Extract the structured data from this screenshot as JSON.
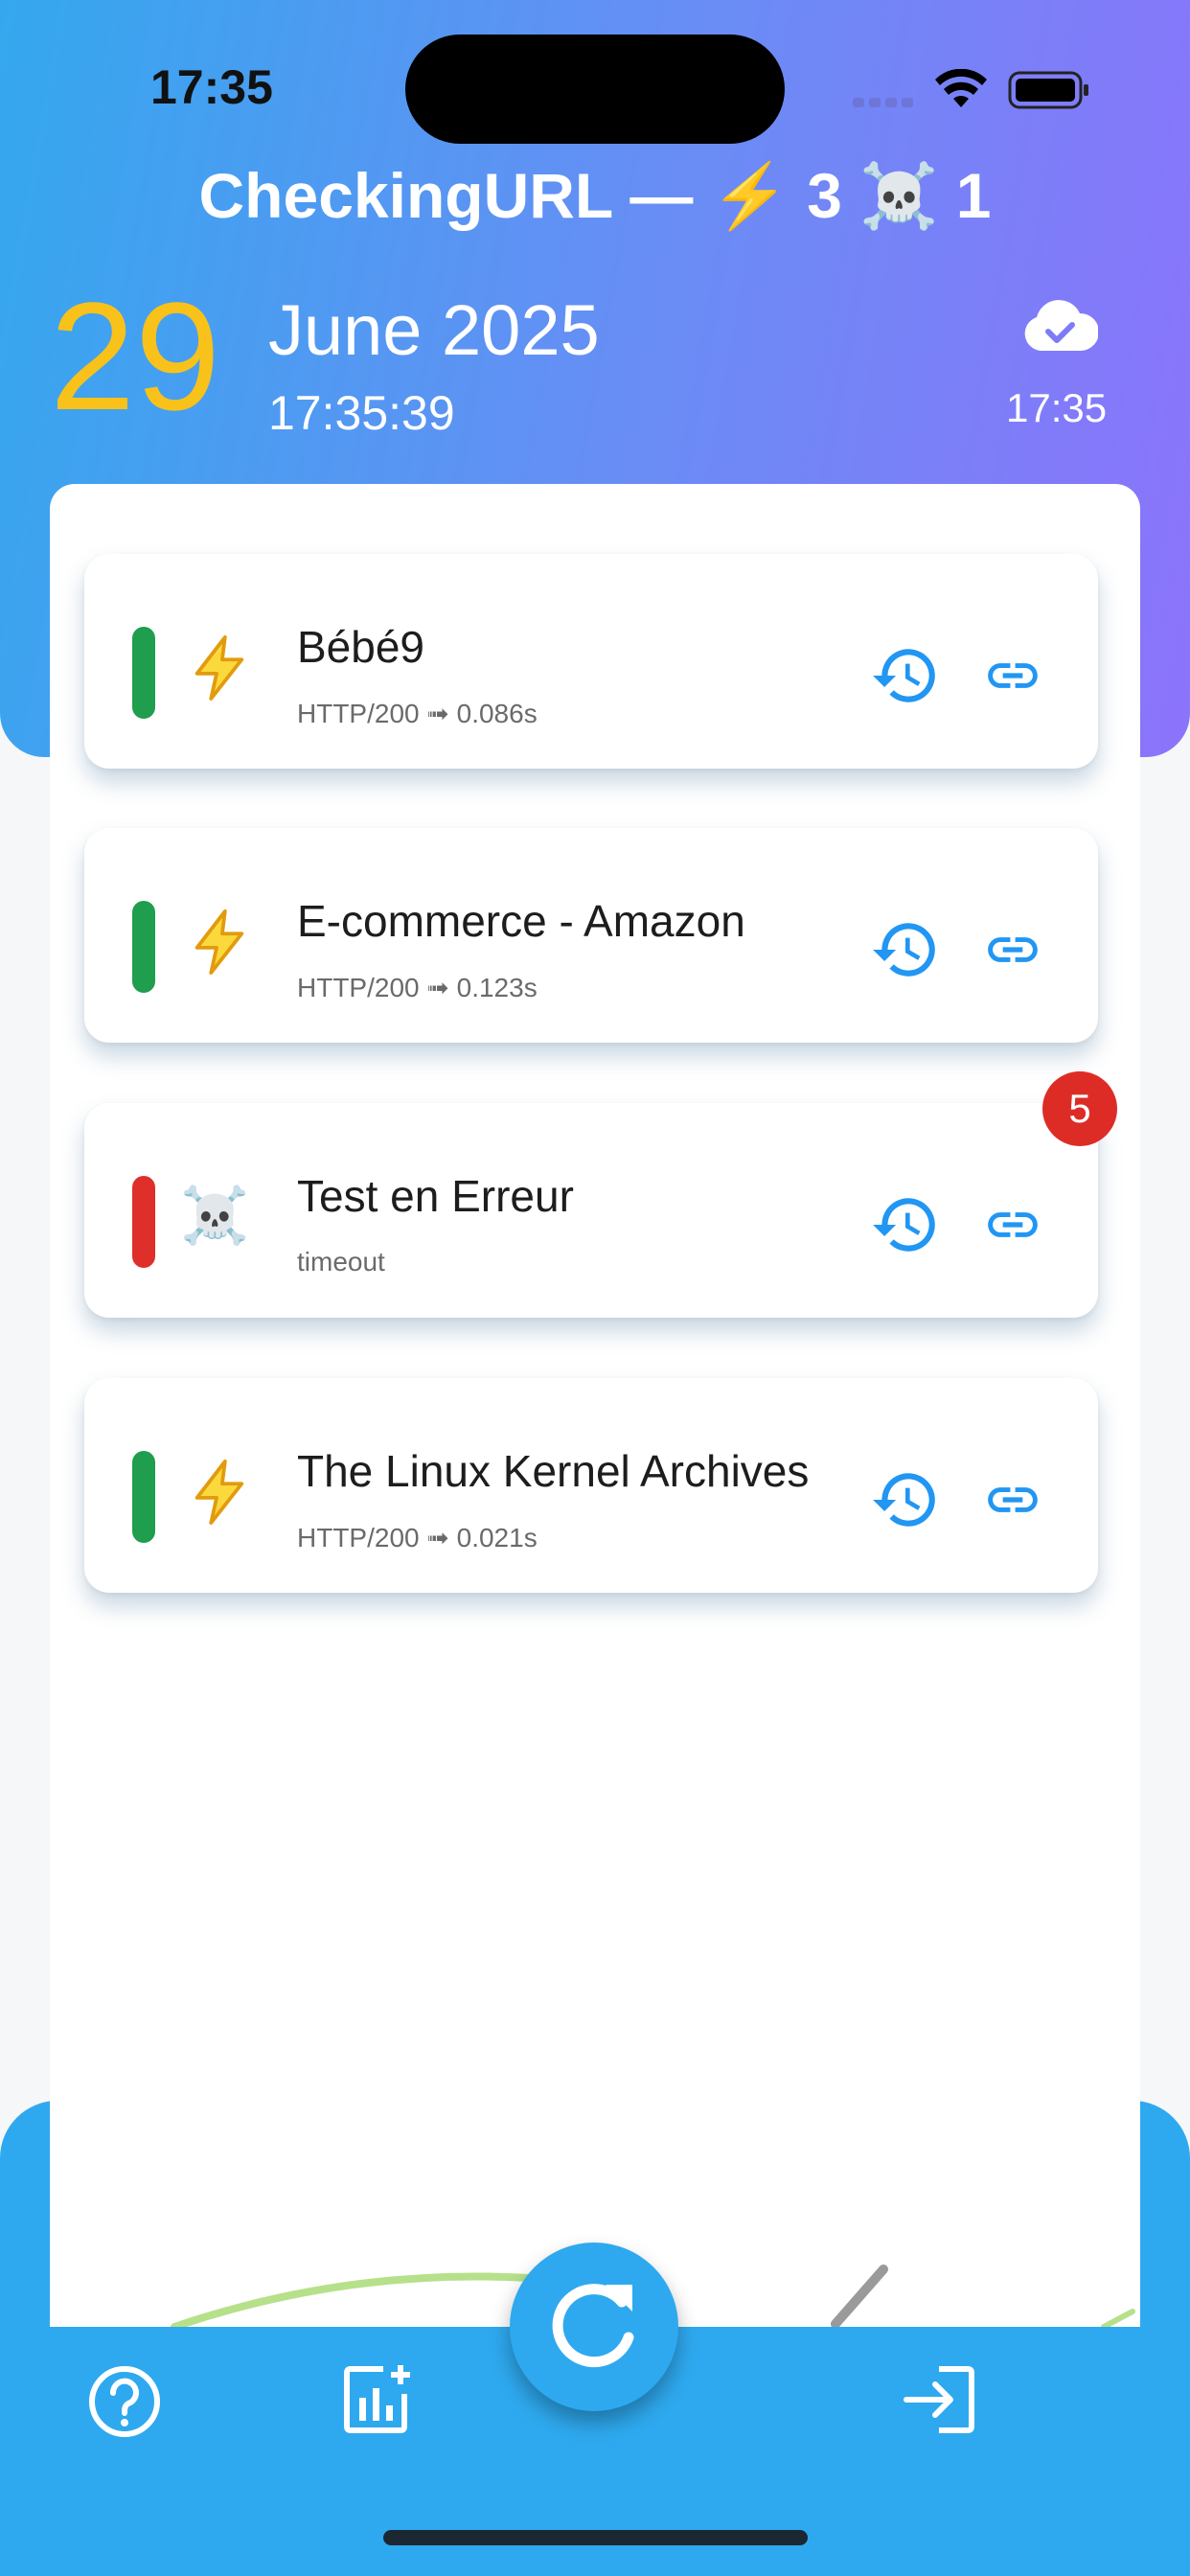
{
  "status_bar": {
    "time": "17:35"
  },
  "header": {
    "title": "CheckingURL — ⚡ 3 ☠️ 1",
    "day": "29",
    "month_year": "June 2025",
    "clock": "17:35:39",
    "sync_time": "17:35"
  },
  "cards": [
    {
      "name": "Bébé9",
      "detail": "HTTP/200 ➟ 0.086s",
      "status": "ok",
      "icon": "lightning-icon"
    },
    {
      "name": "E-commerce - Amazon",
      "detail": "HTTP/200 ➟ 0.123s",
      "status": "ok",
      "icon": "lightning-icon"
    },
    {
      "name": "Test en Erreur",
      "detail": "timeout",
      "status": "error",
      "icon": "skull-icon",
      "badge": "5"
    },
    {
      "name": "The Linux Kernel Archives",
      "detail": "HTTP/200 ➟ 0.021s",
      "status": "ok",
      "icon": "lightning-icon"
    }
  ],
  "colors": {
    "accent": "#2ea9ef",
    "ok": "#1f9e4d",
    "error": "#df2f2a",
    "day": "#f8c21a",
    "gradient_end": "#8c73fb"
  },
  "bottom_nav": [
    "help-icon",
    "stats-add-icon",
    "refresh-icon",
    "logout-icon"
  ]
}
